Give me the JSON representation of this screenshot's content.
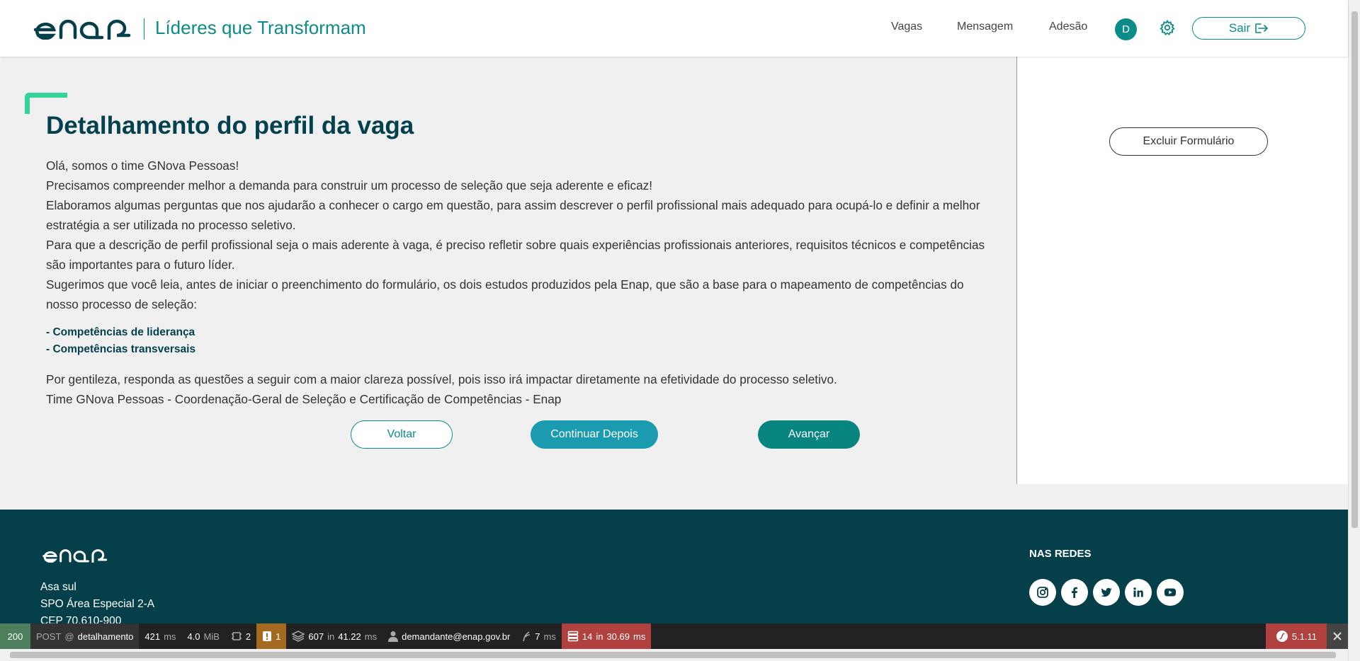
{
  "header": {
    "app_title": "Líderes que Transformam",
    "nav": [
      "Vagas",
      "Mensagem",
      "Adesão"
    ],
    "avatar_initial": "D",
    "logout_label": "Sair"
  },
  "main": {
    "title": "Detalhamento do perfil da vaga",
    "paragraphs": [
      "Olá, somos o time GNova Pessoas!",
      "Precisamos compreender melhor a demanda para construir um processo de seleção que seja aderente e eficaz!",
      "Elaboramos algumas perguntas que nos ajudarão a conhecer o cargo em questão, para assim descrever o perfil profissional mais adequado para ocupá-lo e definir a melhor estratégia a ser utilizada no processo seletivo.",
      "Para que a descrição de perfil profissional seja o mais aderente à vaga, é preciso refletir sobre quais experiências profissionais anteriores, requisitos técnicos e competências são importantes para o futuro líder.",
      "Sugerimos que você leia, antes de iniciar o preenchimento do formulário, os dois estudos produzidos pela Enap, que são a base para o mapeamento de competências do nosso processo de seleção:"
    ],
    "links": [
      "- Competências de liderança",
      "- Competências transversais"
    ],
    "closing": [
      "Por gentileza, responda as questões a seguir com a maior clareza possível, pois isso irá impactar diretamente na efetividade do processo seletivo.",
      "Time GNova Pessoas - Coordenação-Geral de Seleção e Certificação de Competências - Enap"
    ],
    "buttons": {
      "back": "Voltar",
      "later": "Continuar Depois",
      "next": "Avançar"
    }
  },
  "sidebar": {
    "delete_form": "Excluir Formulário"
  },
  "footer": {
    "address": [
      "Asa sul",
      "SPO Área Especial 2-A",
      "CEP 70.610-900"
    ],
    "social_title": "NAS REDES",
    "social_icons": [
      "instagram-icon",
      "facebook-icon",
      "twitter-icon",
      "linkedin-icon",
      "youtube-icon"
    ]
  },
  "debug_toolbar": {
    "status": "200",
    "method": "POST",
    "route": "detalhamento",
    "time_ms": "421",
    "memory": "4.0",
    "memory_unit": "MiB",
    "forms": "2",
    "logs": "1",
    "cache_calls": "607",
    "cache_time": "41.22",
    "user": "demandante@enap.gov.br",
    "twig_ms": "7",
    "db_queries": "14",
    "db_time": "30.69",
    "version": "5.1.11",
    "labels": {
      "at": "@",
      "ms": "ms",
      "in": "in"
    }
  },
  "colors": {
    "teal": "#0b8c88",
    "dark_teal": "#05404a",
    "accent_green": "#34d399",
    "button_blue": "#1b9bb0"
  }
}
